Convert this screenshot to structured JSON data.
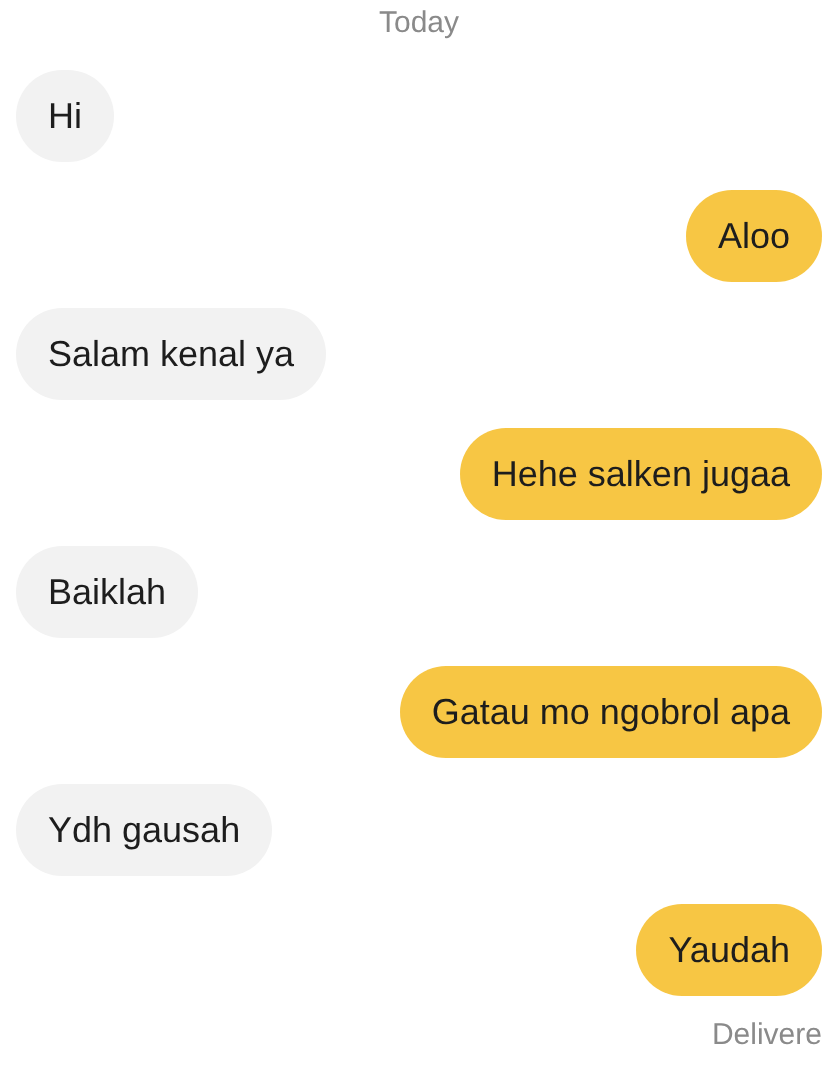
{
  "date_label": "Today",
  "messages": [
    {
      "kind": "received",
      "text": "Hi"
    },
    {
      "kind": "sent",
      "text": "Aloo"
    },
    {
      "kind": "received",
      "text": "Salam kenal ya"
    },
    {
      "kind": "sent",
      "text": "Hehe salken jugaa"
    },
    {
      "kind": "received",
      "text": "Baiklah"
    },
    {
      "kind": "sent",
      "text": "Gatau mo ngobrol apa"
    },
    {
      "kind": "received",
      "text": "Ydh gausah"
    },
    {
      "kind": "sent",
      "text": "Yaudah"
    }
  ],
  "status": "Delivere"
}
